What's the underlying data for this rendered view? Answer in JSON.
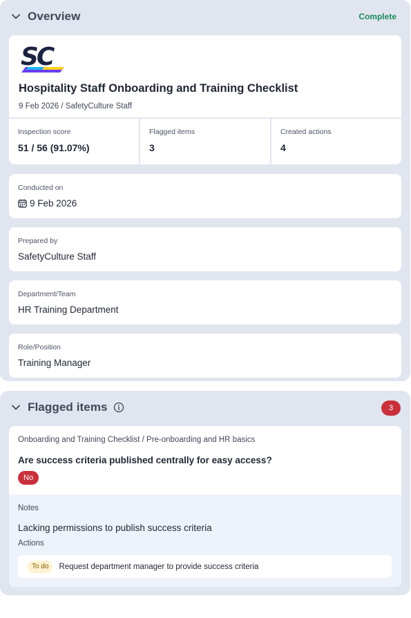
{
  "overview": {
    "title": "Overview",
    "status": "Complete",
    "logo_text": "SC",
    "report_title": "Hospitality Staff Onboarding and Training Checklist",
    "report_sub": "9 Feb 2026 / SafetyCulture Staff",
    "stats": [
      {
        "label": "Inspection score",
        "value": "51 / 56 (91.07%)"
      },
      {
        "label": "Flagged items",
        "value": "3"
      },
      {
        "label": "Created actions",
        "value": "4"
      }
    ],
    "fields": [
      {
        "label": "Conducted on",
        "value": "9 Feb 2026"
      },
      {
        "label": "Prepared by",
        "value": "SafetyCulture Staff"
      },
      {
        "label": "Department/Team",
        "value": "HR Training Department"
      },
      {
        "label": "Role/Position",
        "value": "Training Manager"
      }
    ]
  },
  "flagged": {
    "title": "Flagged items",
    "count": "3",
    "item": {
      "breadcrumb": "Onboarding and Training Checklist / Pre-onboarding and HR basics",
      "question": "Are success criteria published centrally for easy access?",
      "answer": "No",
      "notes_label": "Notes",
      "notes": "Lacking permissions to publish success criteria",
      "actions_label": "Actions",
      "action": {
        "status": "To do",
        "text": "Request department manager to provide success criteria"
      }
    }
  },
  "colors": {
    "complete": "#1b8a5a",
    "flag": "#c8313b",
    "section_bg": "#e1e5ef",
    "todo_bg": "#fdf2d2"
  }
}
